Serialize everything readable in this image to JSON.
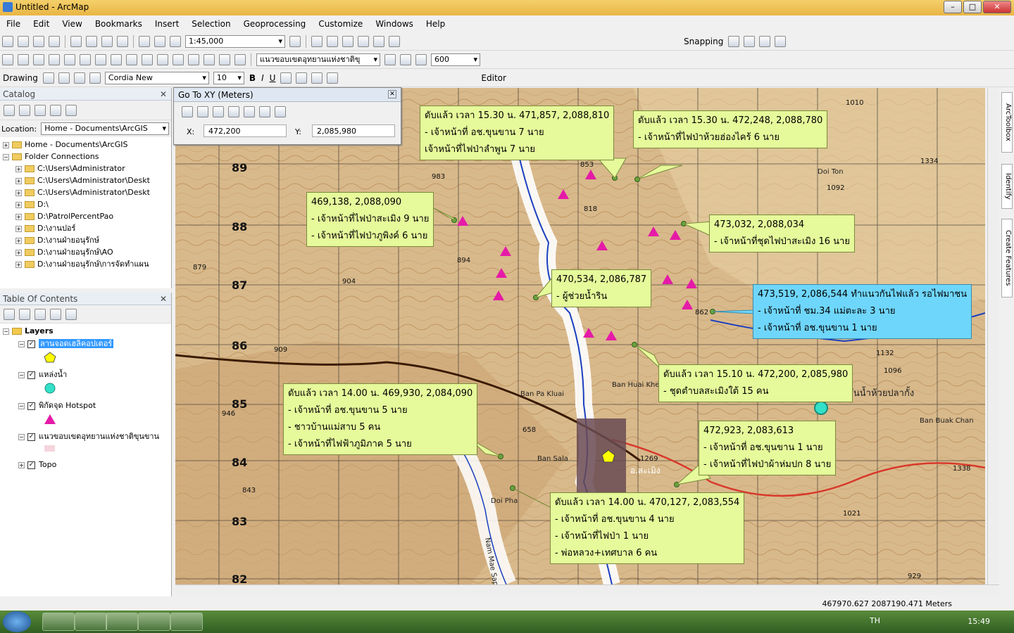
{
  "window": {
    "title": "Untitled - ArcMap"
  },
  "menu": [
    "File",
    "Edit",
    "View",
    "Bookmarks",
    "Insert",
    "Selection",
    "Geoprocessing",
    "Customize",
    "Windows",
    "Help"
  ],
  "toolbar": {
    "scale": "1:45,000",
    "layer_combo": "แนวขอบเขตอุทยานแห่งชาติขุ",
    "resolution": "600",
    "snapping": "Snapping",
    "drawing": "Drawing",
    "font": "Cordia New",
    "font_size": "10",
    "editor": "Editor"
  },
  "catalog": {
    "title": "Catalog",
    "location_label": "Location:",
    "location_value": "Home - Documents\\ArcGIS",
    "items": [
      "Home - Documents\\ArcGIS",
      "Folder Connections",
      "C:\\Users\\Administrator",
      "C:\\Users\\Administrator\\Deskt",
      "C:\\Users\\Administrator\\Deskt",
      "D:\\",
      "D:\\PatrolPercentPao",
      "D:\\งานปอร์",
      "D:\\งานฝ่ายอนุรักษ์",
      "D:\\งานฝ่ายอนุรักษ์\\AO",
      "D:\\งานฝ่ายอนุรักษ์\\การจัดทำแผน"
    ]
  },
  "toc": {
    "title": "Table Of Contents",
    "root": "Layers",
    "layers": [
      "ลานจอดเฮลิคอปเตอร์",
      "แหล่งน้ำ",
      "พิกัดจุด Hotspot",
      "แนวขอบเขตอุทยานแห่งชาติขุนขาน",
      "Topo"
    ]
  },
  "goto": {
    "title": "Go To XY    (Meters)",
    "x_label": "X:",
    "x_value": "472,200",
    "y_label": "Y:",
    "y_value": "2,085,980"
  },
  "callouts": [
    [
      "ดับแล้ว เวลา 15.30 น. 471,857, 2,088,810",
      "- เจ้าหน้าที่ อช.ขุนขาน 7 นาย",
      "เจ้าหน้าที่ไฟป่าลำพูน 7 นาย"
    ],
    [
      "ดับแล้ว เวลา 15.30 น. 472,248, 2,088,780",
      "- เจ้าหน้าที่ไฟป่าห้วยฮ่องไคร้ 6 นาย"
    ],
    [
      "469,138, 2,088,090",
      "- เจ้าหน้าที่ไฟป่าสะเมิง 9 นาย",
      "- เจ้าหน้าที่ไฟป่าภูพิงค์ 6 นาย"
    ],
    [
      "473,032, 2,088,034",
      "- เจ้าหน้าที่ชุดไฟป่าสะเมิง 16 นาย"
    ],
    [
      "470,534, 2,086,787",
      "- ผู้ช่วยน้ำริน"
    ],
    [
      "473,519, 2,086,544 ทำแนวกันไฟแล้ว รอไฟมาชน",
      "- เจ้าหน้าที่ ชม.34 แม่ตะละ 3 นาย",
      "- เจ้าหน้าที่ อช.ขุนขาน 1 นาย"
    ],
    [
      "ดับแล้ว เวลา 15.10 น. 472,200, 2,085,980",
      "- ชุดตำบลสะเมิงใต้ 15 คน"
    ],
    [
      "ดับแล้ว เวลา 14.00 น. 469,930, 2,084,090",
      "- เจ้าหน้าที่ อช.ขุนขาน 5 นาย",
      "- ชาวบ้านแม่สาบ 5 คน",
      "- เจ้าหน้าที่ไฟฟ้าภูมิภาค 5 นาย"
    ],
    [
      "472,923, 2,083,613",
      "- เจ้าหน้าที่ อช.ขุนขาน 1 นาย",
      "- เจ้าหน้าที่ไฟป่าผ้าห่มปก 8 นาย"
    ],
    [
      "ดับแล้ว เวลา 14.00 น. 470,127, 2,083,554",
      "- เจ้าหน้าที่ อช.ขุนขาน 4 นาย",
      "- เจ้าหน้าที่ไฟป่า 1 นาย",
      "- พ่อหลวง+เทศบาล 6 คน"
    ]
  ],
  "map_labels": {
    "grid": [
      "89",
      "88",
      "87",
      "86",
      "85",
      "84",
      "83",
      "82"
    ],
    "places": [
      "Doi Pha",
      "Doi Ton",
      "Ban Huai Khek",
      "Ban Pa Kluai",
      "Ban Sala",
      "Ban Buak Chan",
      "Nam Mae Sap",
      "กันน้ำห้วยปลากั้ง",
      "อ.สะเมิง"
    ],
    "spots": [
      "1010",
      "1334",
      "1092",
      "818",
      "894",
      "879",
      "904",
      "909",
      "862",
      "1132",
      "1096",
      "1338",
      "1021",
      "946",
      "843",
      "929",
      "658",
      "853",
      "983",
      "1269"
    ]
  },
  "tabs": [
    "ArcToolbox",
    "Identify",
    "Create Features"
  ],
  "status": {
    "coords": "467970.627  2087190.471 Meters"
  },
  "taskbar": {
    "lang": "TH",
    "time": "15:49"
  }
}
